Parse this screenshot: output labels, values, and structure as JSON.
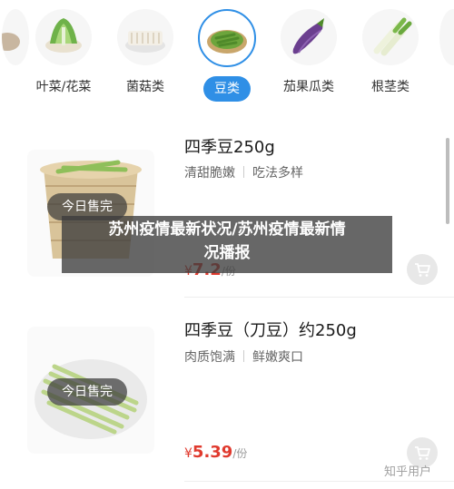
{
  "categories": [
    {
      "label": "",
      "icon": "vegetable-partial-icon"
    },
    {
      "label": "叶菜/花菜",
      "icon": "leafy-vegetable-icon"
    },
    {
      "label": "菌菇类",
      "icon": "mushroom-icon"
    },
    {
      "label": "豆类",
      "icon": "bean-icon",
      "active": true
    },
    {
      "label": "茄果瓜类",
      "icon": "eggplant-icon"
    },
    {
      "label": "根茎类",
      "icon": "root-vegetable-icon"
    }
  ],
  "products": [
    {
      "name": "四季豆250g",
      "tags": [
        "清甜脆嫩",
        "吃法多样"
      ],
      "price_symbol": "¥",
      "price": "7.2",
      "unit": "/份",
      "badge": "今日售完"
    },
    {
      "name": "四季豆（刀豆）约250g",
      "tags": [
        "肉质饱满",
        "鲜嫩爽口"
      ],
      "price_symbol": "¥",
      "price": "5.39",
      "unit": "/份",
      "badge": "今日售完"
    }
  ],
  "overlay": {
    "line1": "苏州疫情最新状况/苏州疫情最新情",
    "line2": "况播报"
  },
  "watermark": "知乎用户",
  "colors": {
    "accent": "#2f8fe6",
    "price": "#e03a2e"
  }
}
